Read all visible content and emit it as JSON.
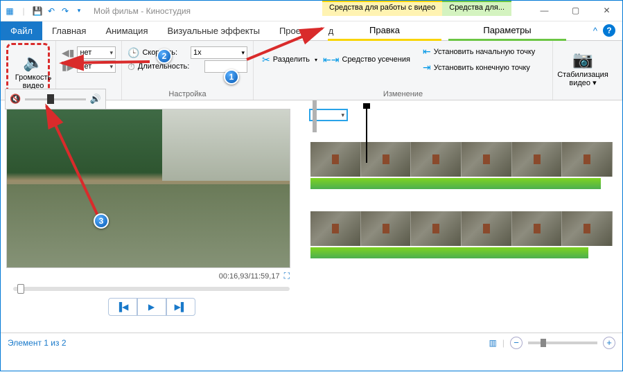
{
  "title": "Мой фильм - Киностудия",
  "ctxTabs": {
    "video": "Средства для работы с видео",
    "tool": "Средства для..."
  },
  "winTabs": {
    "file": "Файл",
    "home": "Главная",
    "anim": "Анимация",
    "vfx": "Визуальные эффекты",
    "project": "Проект",
    "view": "д"
  },
  "subTabs": {
    "edit": "Правка",
    "params": "Параметры"
  },
  "ribbon": {
    "volume": "Громкость\nвидео",
    "fadeInValue": "нет",
    "fadeOutValue": "нет",
    "speedLabel": "Скорость:",
    "speedValue": "1x",
    "durationLabel": "Длительность:",
    "settingsGroup": "Настройка",
    "split": "Разделить",
    "trimTool": "Средство усечения",
    "setStart": "Установить начальную точку",
    "setEnd": "Установить конечную точку",
    "editGroup": "Изменение",
    "stabilize": "Стабилизация\nвидео ▾"
  },
  "preview": {
    "time": "00:16,93/11:59,17"
  },
  "status": {
    "element": "Элемент 1 из 2"
  },
  "markers": {
    "m1": "1",
    "m2": "2",
    "m3": "3"
  }
}
